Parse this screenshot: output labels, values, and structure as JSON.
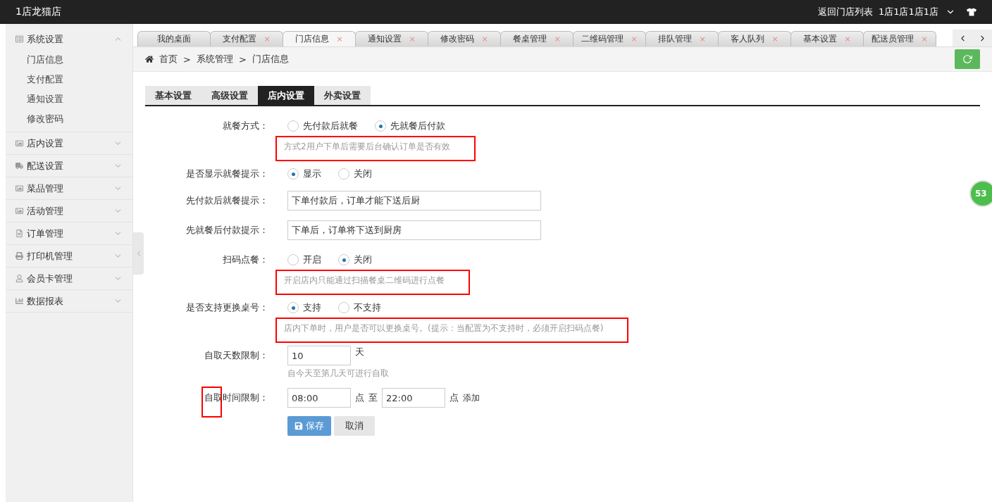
{
  "header": {
    "title": "1店龙猫店",
    "back_link": "返回门店列表",
    "store_name": "1店1店1店1店"
  },
  "sidebar": {
    "items": [
      {
        "label": "系统设置",
        "expanded": true,
        "children": [
          {
            "label": "门店信息"
          },
          {
            "label": "支付配置"
          },
          {
            "label": "通知设置"
          },
          {
            "label": "修改密码"
          }
        ]
      },
      {
        "label": "店内设置",
        "expanded": false
      },
      {
        "label": "配送设置",
        "expanded": false
      },
      {
        "label": "菜品管理",
        "expanded": false
      },
      {
        "label": "活动管理",
        "expanded": false
      },
      {
        "label": "订单管理",
        "expanded": false
      },
      {
        "label": "打印机管理",
        "expanded": false
      },
      {
        "label": "会员卡管理",
        "expanded": false
      },
      {
        "label": "数据报表",
        "expanded": false
      }
    ]
  },
  "page_tabs": [
    {
      "label": "我的桌面",
      "selected": false
    },
    {
      "label": "支付配置",
      "selected": false,
      "close": "×"
    },
    {
      "label": "门店信息",
      "selected": true,
      "close": "×"
    },
    {
      "label": "通知设置",
      "selected": false,
      "close": "×"
    },
    {
      "label": "修改密码",
      "selected": false,
      "close": "×"
    },
    {
      "label": "餐桌管理",
      "selected": false,
      "close": "×"
    },
    {
      "label": "二维码管理",
      "selected": false,
      "close": "×"
    },
    {
      "label": "排队管理",
      "selected": false,
      "close": "×"
    },
    {
      "label": "客人队列",
      "selected": false,
      "close": "×"
    },
    {
      "label": "基本设置",
      "selected": false,
      "close": "×"
    },
    {
      "label": "配送员管理",
      "selected": false,
      "close": "×"
    }
  ],
  "breadcrumb": [
    "首页",
    "系统管理",
    "门店信息"
  ],
  "breadcrumb_separator": ">",
  "settings_tabs": [
    {
      "label": "基本设置",
      "selected": false
    },
    {
      "label": "高级设置",
      "selected": false
    },
    {
      "label": "店内设置",
      "selected": true
    },
    {
      "label": "外卖设置",
      "selected": false
    }
  ],
  "form": [
    {
      "kind": "radio",
      "label": "就餐方式：",
      "options": [
        {
          "label": "先付款后就餐",
          "selected": false
        },
        {
          "label": "先就餐后付款",
          "selected": true
        }
      ],
      "hint": "方式2用户下单后需要后台确认订单是否有效",
      "annotated": true
    },
    {
      "kind": "radio",
      "label": "是否显示就餐提示：",
      "options": [
        {
          "label": "显示",
          "selected": true
        },
        {
          "label": "关闭",
          "selected": false
        }
      ]
    },
    {
      "kind": "text",
      "label": "先付款后就餐提示：",
      "value": "下单付款后，订单才能下送后厨"
    },
    {
      "kind": "text",
      "label": "先就餐后付款提示：",
      "value": "下单后，订单将下送到厨房"
    },
    {
      "kind": "radio",
      "label": "扫码点餐：",
      "options": [
        {
          "label": "开启",
          "selected": false
        },
        {
          "label": "关闭",
          "selected": true
        }
      ],
      "hint": "开启店内只能通过扫描餐桌二维码进行点餐",
      "annotated": true
    },
    {
      "kind": "radio",
      "label": "是否支持更换桌号：",
      "options": [
        {
          "label": "支持",
          "selected": true
        },
        {
          "label": "不支持",
          "selected": false
        }
      ],
      "hint": "店内下单时，用户是否可以更换桌号。(提示：当配置为不支持时，必须开启扫码点餐)",
      "annotated": true
    },
    {
      "kind": "number",
      "label": "自取天数限制：",
      "value": "10",
      "unit": "天",
      "hint": "自今天至第几天可进行自取"
    },
    {
      "kind": "timerange",
      "label": "自取时间限制：",
      "label_annotated": true,
      "from": "08:00",
      "unit_from": "点",
      "to_word": "至",
      "to": "22:00",
      "unit_to": "点",
      "add_link": "添加"
    }
  ],
  "buttons": {
    "save": "保存",
    "cancel": "取消"
  },
  "floating_badge": "53"
}
